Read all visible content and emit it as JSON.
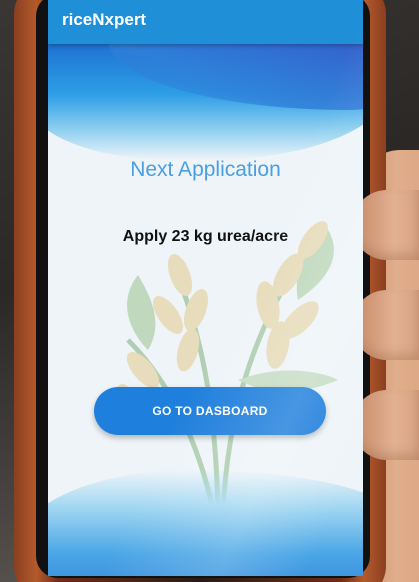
{
  "app": {
    "title": "riceNxpert"
  },
  "main": {
    "heading": "Next Application",
    "message": "Apply 23 kg urea/acre",
    "dashboard_button_label": "GO TO DASBOARD"
  },
  "colors": {
    "app_bar": "#1f8fd8",
    "heading_text": "#4a9fe2",
    "button": "#1f7fdc",
    "message_text": "#111111"
  },
  "icons": [
    "wheat-illustration"
  ]
}
